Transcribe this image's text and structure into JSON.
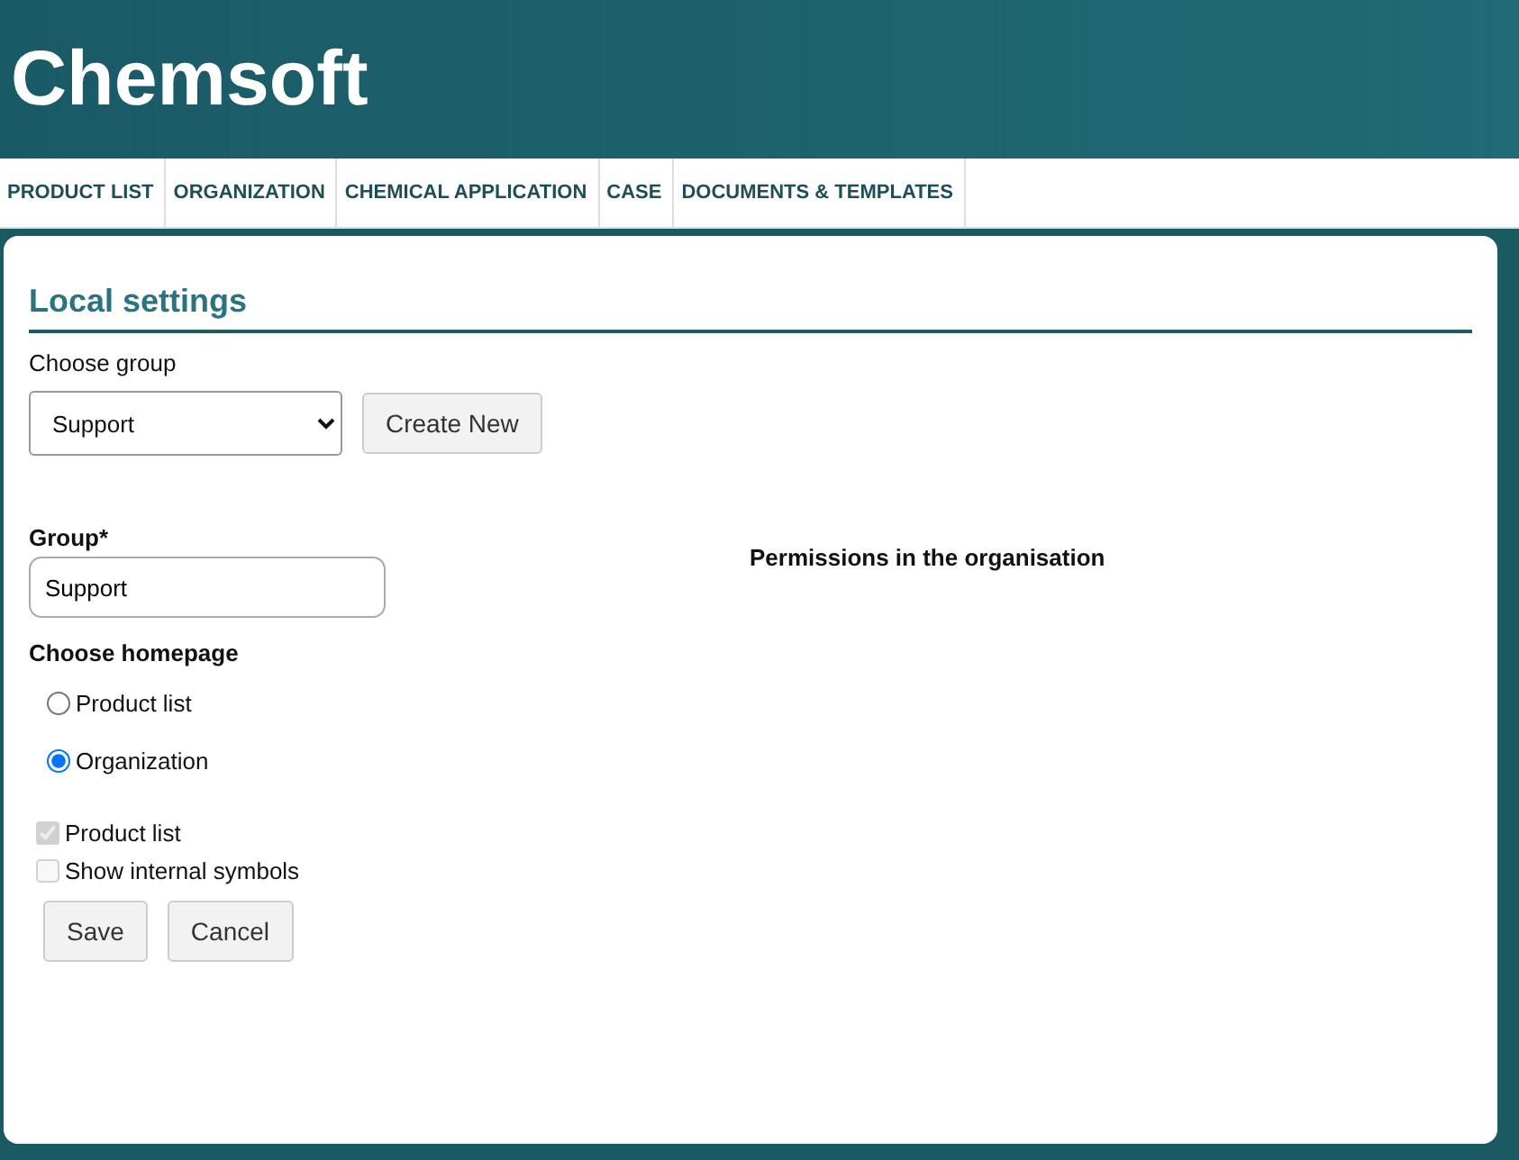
{
  "header": {
    "title": "Chemsoft"
  },
  "nav": [
    {
      "label": "PRODUCT LIST",
      "selected": false
    },
    {
      "label": "ORGANIZATION",
      "selected": false
    },
    {
      "label": "CHEMICAL APPLICATION",
      "selected": false
    },
    {
      "label": "CASE",
      "selected": false
    },
    {
      "label": "DOCUMENTS & TEMPLATES",
      "selected": false
    }
  ],
  "settings": {
    "title": "Local settings",
    "choose_group_label": "Choose group",
    "group_select": "Support",
    "create_button": "Create New",
    "group_label": "Group*",
    "group_value": "Support",
    "homepage_label": "Choose homepage",
    "homepage_options": [
      {
        "label": "Product list",
        "selected": false
      },
      {
        "label": "Organization",
        "selected": true
      }
    ],
    "checkboxes": [
      {
        "label": "Product list",
        "checked": true
      },
      {
        "label": "Show internal symbols",
        "checked": false
      }
    ],
    "permissions_title": "Permissions in the organisation",
    "buttons": [
      "Save",
      "Cancel"
    ]
  }
}
